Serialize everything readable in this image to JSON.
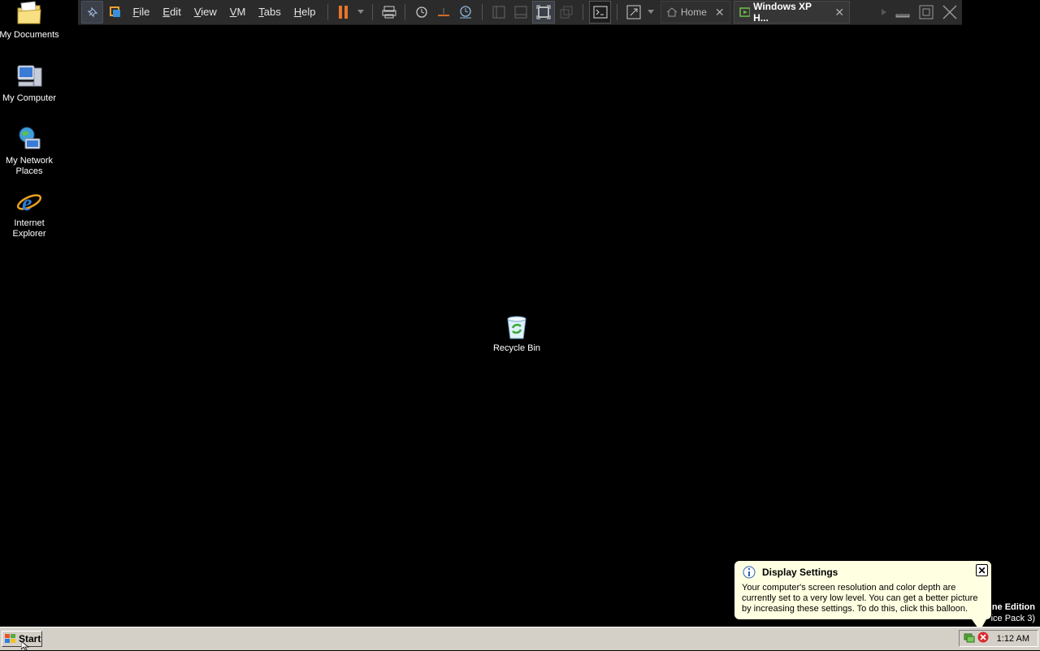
{
  "toolbar": {
    "menus": [
      {
        "key": "F",
        "rest": "ile"
      },
      {
        "key": "E",
        "rest": "dit"
      },
      {
        "key": "V",
        "rest": "iew"
      },
      {
        "key": "V",
        "rest": "M"
      },
      {
        "key": "T",
        "rest": "abs"
      },
      {
        "key": "H",
        "rest": "elp"
      }
    ],
    "tabs": [
      {
        "label": "Home"
      },
      {
        "label": "Windows XP H..."
      }
    ],
    "pause_color": "#e8742a"
  },
  "desktop": {
    "icons": [
      {
        "label": "My Documents"
      },
      {
        "label": "My Computer"
      },
      {
        "label": "My Network Places"
      },
      {
        "label": "Internet Explorer"
      },
      {
        "label": "Recycle Bin"
      }
    ],
    "watermark": {
      "line1": "ne Edition",
      "line2": "ice Pack 3)"
    }
  },
  "balloon": {
    "title": "Display Settings",
    "text": "Your computer's screen resolution and color depth are currently set to a very low level. You can get a better picture by increasing these settings. To do this, click this balloon.",
    "close": "✕"
  },
  "taskbar": {
    "start_label": "Start",
    "clock": "1:12 AM"
  }
}
